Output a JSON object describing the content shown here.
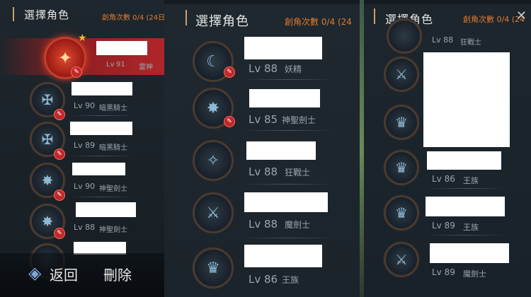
{
  "header": {
    "title": "選擇角色",
    "count_panel1": "創角次數 0/4 (24日",
    "count_panel2": "創角次數 0/4 (24",
    "close_glyph": "✕"
  },
  "panel1": {
    "selected": {
      "lv": "Lv",
      "lv_num": "91",
      "class": "雷神"
    },
    "rows": [
      {
        "lv": "Lv 90",
        "class": "暗黑騎士"
      },
      {
        "lv": "Lv 89",
        "class": "暗黑騎士"
      },
      {
        "lv": "Lv 90",
        "class": "神聖劍士"
      },
      {
        "lv": "Lv 88",
        "class": "神聖劍士"
      }
    ],
    "footer": {
      "back": "返回",
      "delete": "刪除"
    }
  },
  "panel2": {
    "rows": [
      {
        "lv": "Lv 88",
        "class": "妖精"
      },
      {
        "lv": "Lv 85",
        "class": "神聖劍士"
      },
      {
        "lv": "Lv 88",
        "class": "狂戰士"
      },
      {
        "lv": "Lv 88",
        "class": "魔劍士"
      },
      {
        "lv": "Lv 86",
        "class": "王族"
      }
    ]
  },
  "panel3": {
    "rows": [
      {
        "lv": "Lv 88",
        "class": "狂戰士"
      },
      {
        "lv": "",
        "class": ""
      },
      {
        "lv": "",
        "class": ""
      },
      {
        "lv": "Lv 86",
        "class": "王族"
      },
      {
        "lv": "Lv 89",
        "class": "王族"
      },
      {
        "lv": "Lv 89",
        "class": "魔劍士"
      }
    ]
  }
}
